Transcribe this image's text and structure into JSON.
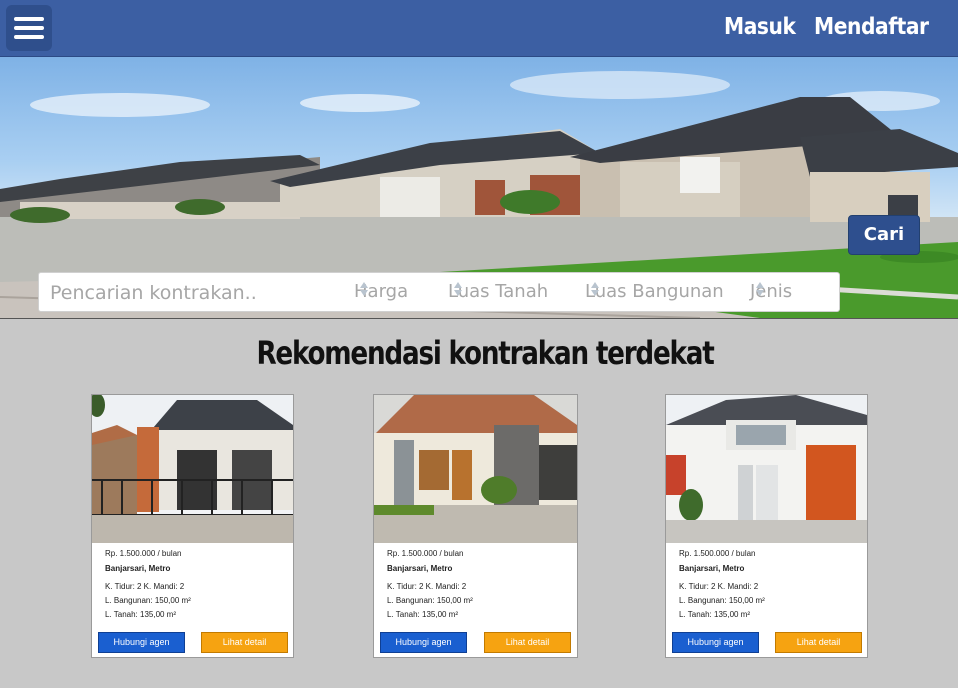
{
  "nav": {
    "login": "Masuk",
    "register": "Mendaftar"
  },
  "search": {
    "placeholder": "Pencarian kontrakan..",
    "filters": [
      "Harga",
      "Luas Tanah",
      "Luas Bangunan",
      "Jenis"
    ],
    "button": "Cari"
  },
  "section": {
    "title": "Rekomendasi kontrakan terdekat"
  },
  "listings": [
    {
      "price": "Rp. 1.500.000  /  bulan",
      "location": "Banjarsari, Metro",
      "rooms": "K. Tidur: 2   K. Mandi: 2",
      "building": "L. Bangunan: 150,00 m²",
      "land": "L. Tanah: 135,00 m²",
      "contact_label": "Hubungi agen",
      "detail_label": "Lihat detail"
    },
    {
      "price": "Rp. 1.500.000  /  bulan",
      "location": "Banjarsari, Metro",
      "rooms": "K. Tidur: 2   K. Mandi: 2",
      "building": "L. Bangunan: 150,00 m²",
      "land": "L. Tanah: 135,00 m²",
      "contact_label": "Hubungi agen",
      "detail_label": "Lihat detail"
    },
    {
      "price": "Rp. 1.500.000  /  bulan",
      "location": "Banjarsari, Metro",
      "rooms": "K. Tidur: 2   K. Mandi: 2",
      "building": "L. Bangunan: 150,00 m²",
      "land": "L. Tanah: 135,00 m²",
      "contact_label": "Hubungi agen",
      "detail_label": "Lihat detail"
    }
  ],
  "icons": {
    "menu": "hamburger-menu-icon",
    "sort": "sort-arrows-icon"
  },
  "colors": {
    "navbar": "#3c5fa3",
    "search_button": "#2e4f8e",
    "contact_button": "#1a5fd0",
    "detail_button": "#f6a311",
    "background": "#c8c8c8"
  }
}
